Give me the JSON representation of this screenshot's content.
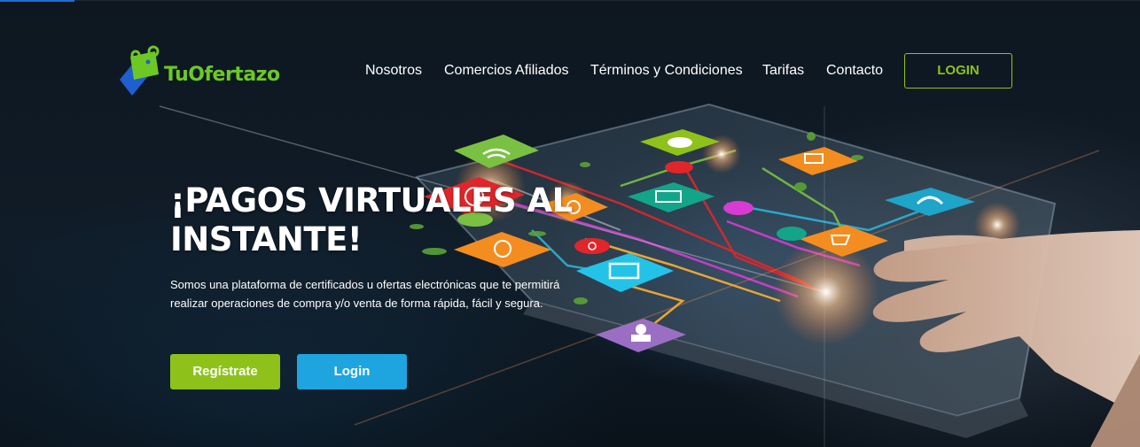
{
  "brand": {
    "logo_text_prefix": "Tu",
    "logo_text_suffix": "Ofertazo",
    "colors": {
      "green": "#8ec21a",
      "blue": "#1ea5e0",
      "logo_green": "#6cc924",
      "logo_blue": "#1f5fd0"
    }
  },
  "nav": {
    "items": [
      {
        "label": "Nosotros"
      },
      {
        "label": "Comercios Afiliados"
      },
      {
        "label": "Términos y Condiciones"
      },
      {
        "label": "Tarifas"
      },
      {
        "label": "Contacto"
      }
    ],
    "login_label": "LOGIN"
  },
  "hero": {
    "headline_line1": "¡PAGOS VIRTUALES AL",
    "headline_line2": "INSTANTE!",
    "subtitle_line1": "Somos una plataforma de certificados u ofertas electrónicas que te permitirá",
    "subtitle_line2": "realizar operaciones de compra y/o venta de forma rápida, fácil y segura.",
    "register_label": "Regístrate",
    "login_label": "Login"
  },
  "icons": {
    "background": "tablet-with-hand-and-floating-app-icons",
    "app_tiles": [
      "wifi-icon",
      "cloud-icon",
      "mobile-icon",
      "headset-icon",
      "target-icon",
      "laptop-icon",
      "monitor-icon",
      "cart-icon",
      "lightbulb-icon",
      "user-icon",
      "at-sign-icon"
    ]
  }
}
